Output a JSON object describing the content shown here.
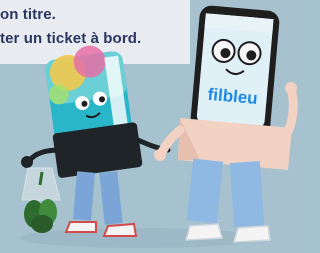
{
  "banner": {
    "line1": "on titre.",
    "line2": "ter un ticket à bord."
  },
  "phone": {
    "brand": "filbleu"
  },
  "colors": {
    "background": "#a6c2cf",
    "text": "#2b3561",
    "brand_blue": "#1e88e5"
  }
}
